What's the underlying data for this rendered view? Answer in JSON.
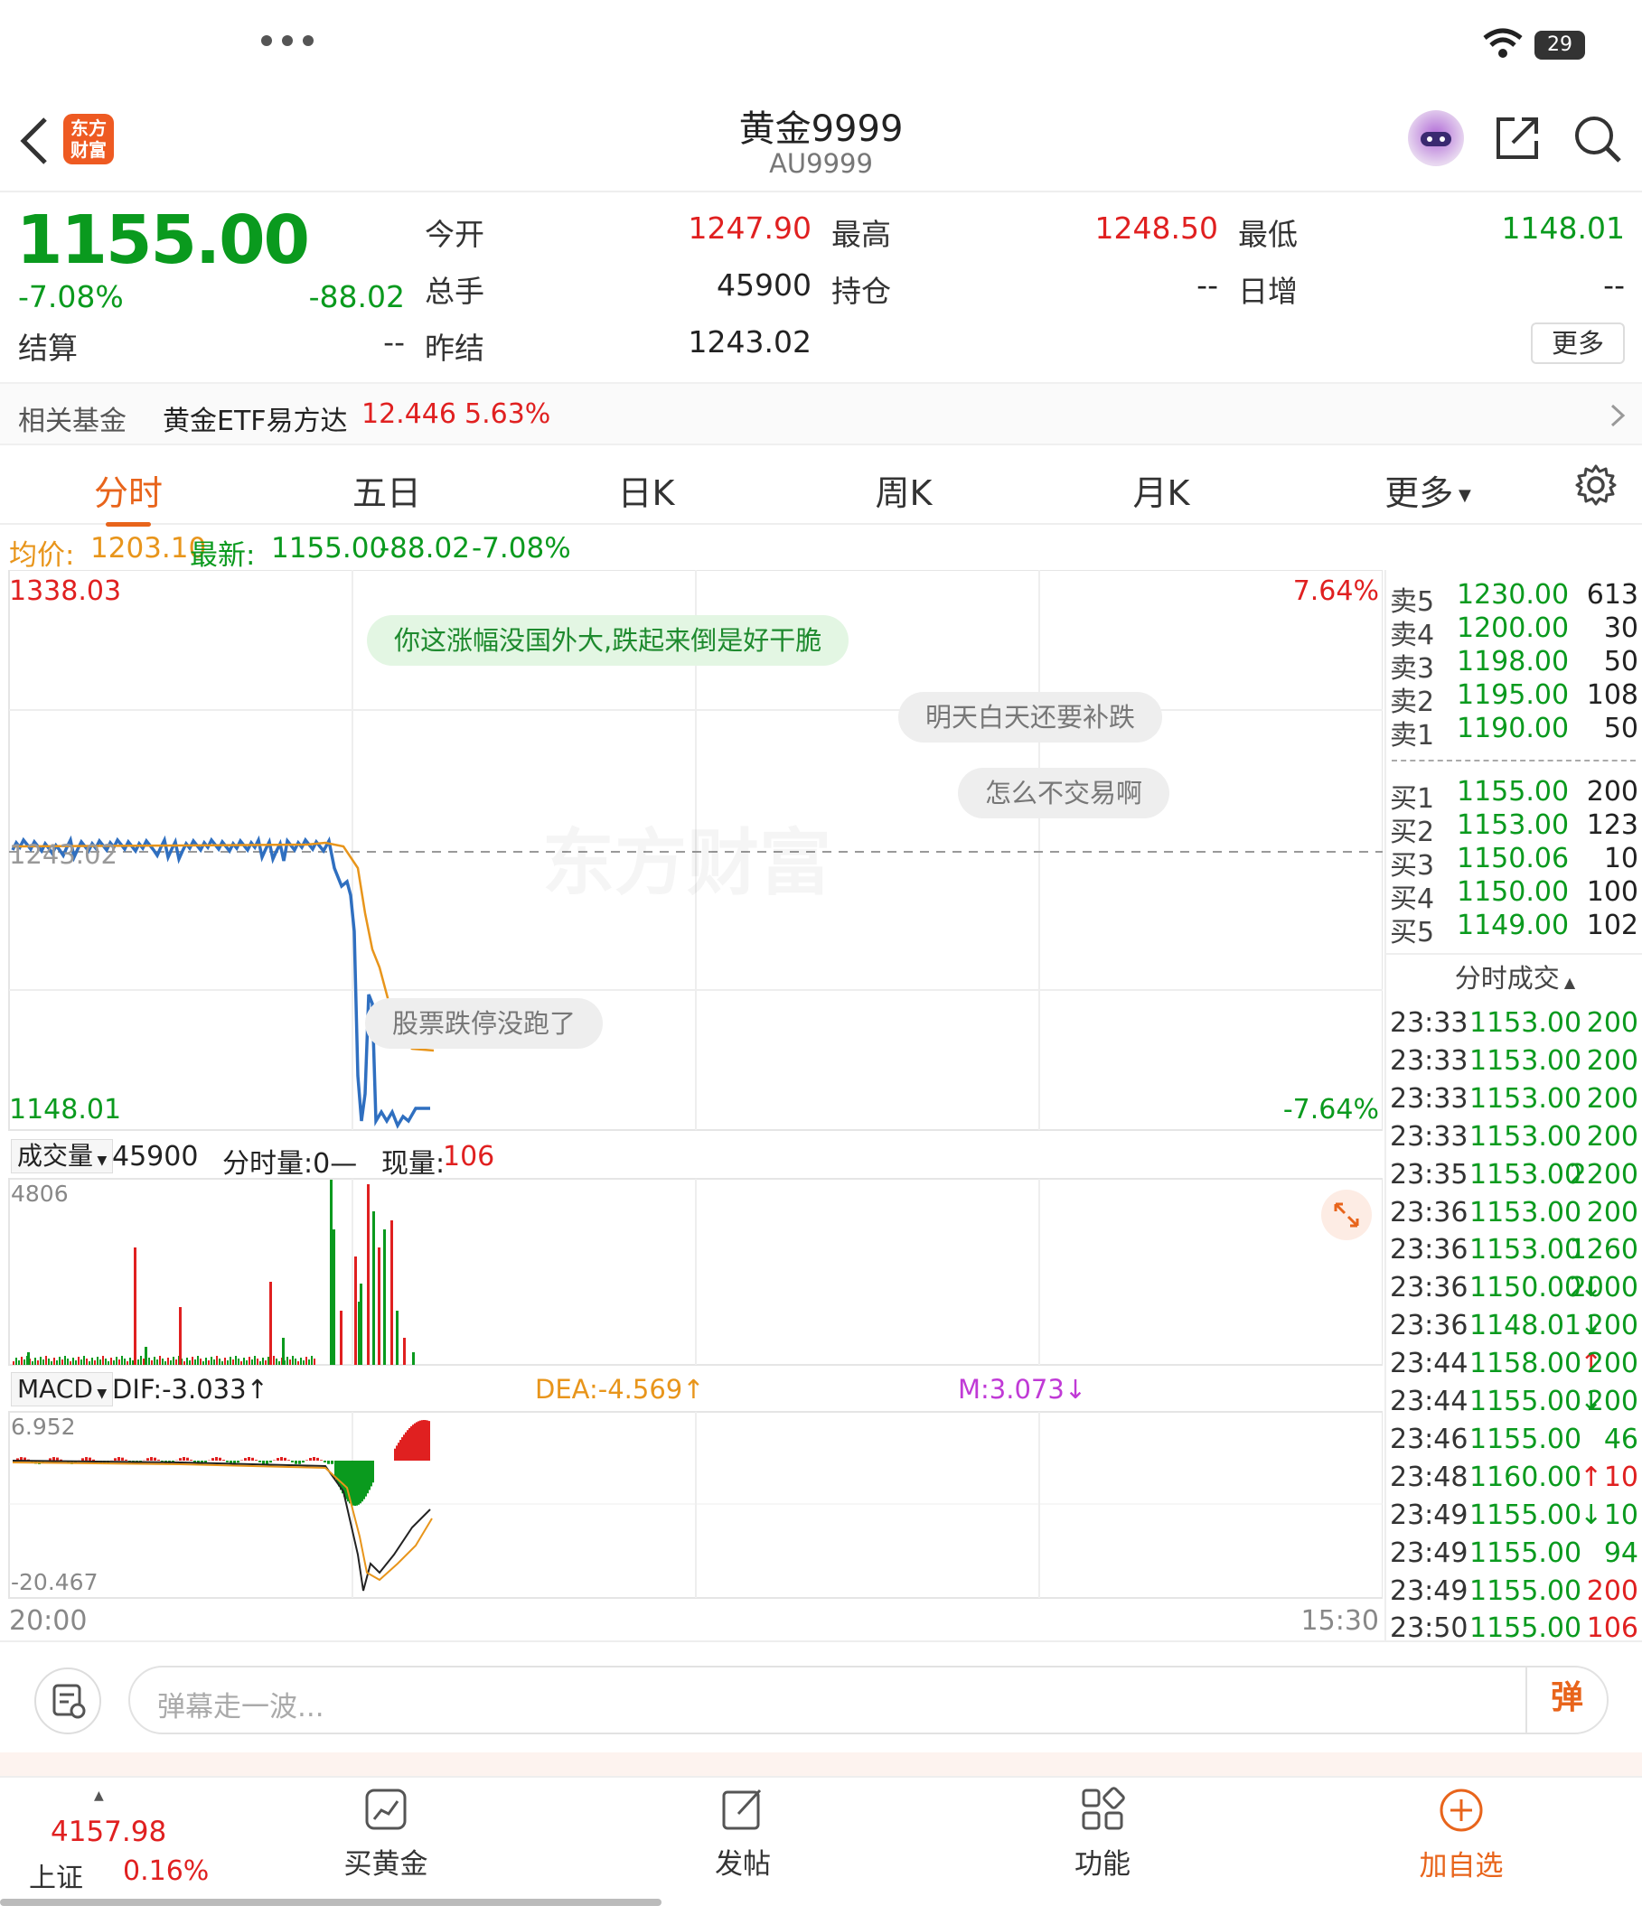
{
  "status_bar": {
    "battery": "29"
  },
  "header": {
    "title": "黄金9999",
    "code": "AU9999",
    "logo_text": "东方财富"
  },
  "quote": {
    "price": "1155.00",
    "change_pct": "-7.08%",
    "change": "-88.02",
    "settle_label": "结算",
    "settle_value": "--",
    "open_label": "今开",
    "open_value": "1247.90",
    "volume_label": "总手",
    "volume_value": "45900",
    "prev_settle_label": "昨结",
    "prev_settle_value": "1243.02",
    "high_label": "最高",
    "high_value": "1248.50",
    "position_label": "持仓",
    "position_value": "--",
    "low_label": "最低",
    "low_value": "1148.01",
    "daily_inc_label": "日增",
    "daily_inc_value": "--",
    "more_button": "更多"
  },
  "fund": {
    "label": "相关基金",
    "name": "黄金ETF易方达",
    "price": "12.446",
    "pct": "5.63%"
  },
  "tabs": [
    {
      "label": "分时"
    },
    {
      "label": "五日"
    },
    {
      "label": "日K"
    },
    {
      "label": "周K"
    },
    {
      "label": "月K"
    },
    {
      "label": "更多"
    }
  ],
  "avg_line": {
    "avg_label": "均价:",
    "avg_value": "1203.10",
    "latest_label": "最新:",
    "latest_value": "1155.00",
    "change": "-88.02",
    "pct": "-7.08%"
  },
  "price_chart": {
    "y_max": "1338.03",
    "y_min": "1148.01",
    "prev_close": "1243.02",
    "pct_top": "7.64%",
    "pct_bottom": "-7.64%",
    "watermark": "东方财富",
    "x_start": "20:00",
    "x_end": "15:30"
  },
  "danmu": [
    "你这涨幅没国外大,跌起来倒是好干脆",
    "明天白天还要补跌",
    "怎么不交易啊",
    "股票跌停没跑了"
  ],
  "volume_panel": {
    "selector": "成交量",
    "total": "45900",
    "tick_label": "分时量:0—",
    "now_label": "现量:",
    "now_value": "106",
    "y_max": "4806"
  },
  "macd_panel": {
    "selector": "MACD",
    "dif": "DIF:-3.033↑",
    "dea": "DEA:-4.569↑",
    "m": "M:3.073↓",
    "y_max": "6.952",
    "y_min": "-20.467"
  },
  "order_book": {
    "asks": [
      {
        "label": "卖5",
        "price": "1230.00",
        "qty": "613"
      },
      {
        "label": "卖4",
        "price": "1200.00",
        "qty": "30"
      },
      {
        "label": "卖3",
        "price": "1198.00",
        "qty": "50"
      },
      {
        "label": "卖2",
        "price": "1195.00",
        "qty": "108"
      },
      {
        "label": "卖1",
        "price": "1190.00",
        "qty": "50"
      }
    ],
    "bids": [
      {
        "label": "买1",
        "price": "1155.00",
        "qty": "200"
      },
      {
        "label": "买2",
        "price": "1153.00",
        "qty": "123"
      },
      {
        "label": "买3",
        "price": "1150.06",
        "qty": "10"
      },
      {
        "label": "买4",
        "price": "1150.00",
        "qty": "100"
      },
      {
        "label": "买5",
        "price": "1149.00",
        "qty": "102"
      }
    ],
    "trades_title": "分时成交",
    "trades": [
      {
        "time": "23:33",
        "price": "1153.00",
        "qty": "200",
        "dir": "",
        "color": "green"
      },
      {
        "time": "23:33",
        "price": "1153.00",
        "qty": "200",
        "dir": "",
        "color": "green"
      },
      {
        "time": "23:33",
        "price": "1153.00",
        "qty": "200",
        "dir": "",
        "color": "green"
      },
      {
        "time": "23:33",
        "price": "1153.00",
        "qty": "200",
        "dir": "",
        "color": "green"
      },
      {
        "time": "23:35",
        "price": "1153.00",
        "qty": "2200",
        "dir": "",
        "color": "green"
      },
      {
        "time": "23:36",
        "price": "1153.00",
        "qty": "200",
        "dir": "",
        "color": "green"
      },
      {
        "time": "23:36",
        "price": "1153.00",
        "qty": "1260",
        "dir": "",
        "color": "green"
      },
      {
        "time": "23:36",
        "price": "1150.00",
        "qty": "2000",
        "dir": "↓",
        "color": "green"
      },
      {
        "time": "23:36",
        "price": "1148.01",
        "qty": "200",
        "dir": "↓",
        "color": "green"
      },
      {
        "time": "23:44",
        "price": "1158.00",
        "qty": "200",
        "dir": "↑",
        "color": "green"
      },
      {
        "time": "23:44",
        "price": "1155.00",
        "qty": "200",
        "dir": "↓",
        "color": "green"
      },
      {
        "time": "23:46",
        "price": "1155.00",
        "qty": "46",
        "dir": "",
        "color": "green"
      },
      {
        "time": "23:48",
        "price": "1160.00",
        "qty": "10",
        "dir": "↑",
        "color": "red"
      },
      {
        "time": "23:49",
        "price": "1155.00",
        "qty": "10",
        "dir": "↓",
        "color": "green"
      },
      {
        "time": "23:49",
        "price": "1155.00",
        "qty": "94",
        "dir": "",
        "color": "green"
      },
      {
        "time": "23:49",
        "price": "1155.00",
        "qty": "200",
        "dir": "",
        "color": "red"
      },
      {
        "time": "23:50",
        "price": "1155.00",
        "qty": "106",
        "dir": "",
        "color": "red"
      }
    ]
  },
  "chat": {
    "placeholder": "弹幕走一波...",
    "send_label": "弹"
  },
  "bottom_nav": {
    "index_value": "4157.98",
    "index_name": "上证",
    "index_pct": "0.16%",
    "items": [
      {
        "label": "买黄金"
      },
      {
        "label": "发帖"
      },
      {
        "label": "功能"
      },
      {
        "label": "加自选"
      }
    ]
  },
  "colors": {
    "up": "#e02020",
    "down": "#0a9a1e",
    "accent": "#e8641b",
    "price_line": "#2f6fc0",
    "avg_line": "#e8951b"
  }
}
